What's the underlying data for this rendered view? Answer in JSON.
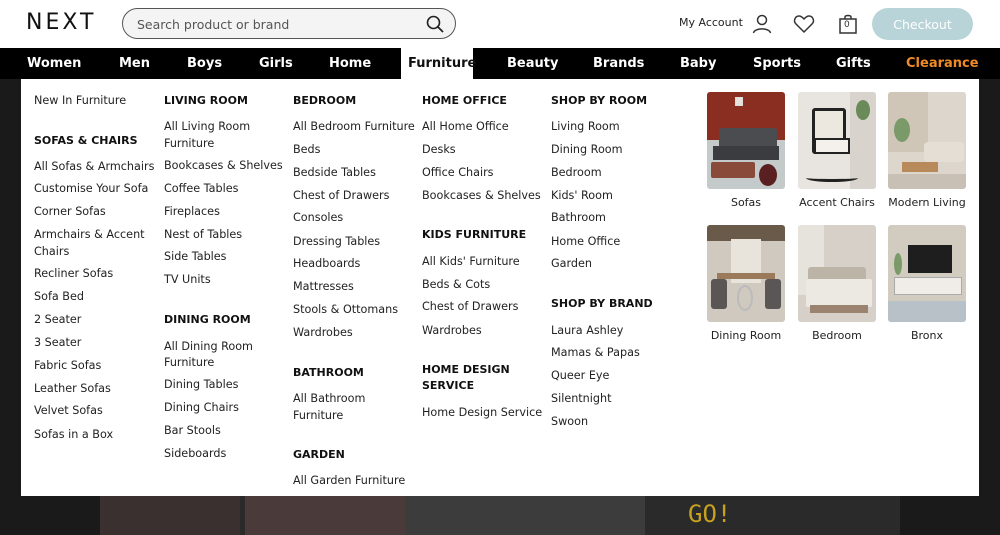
{
  "header": {
    "logo": "NEXT",
    "search_placeholder": "Search product or brand",
    "account_label": "My Account",
    "checkout_label": "Checkout",
    "bag_count": "0"
  },
  "nav": {
    "items": [
      "Women",
      "Men",
      "Boys",
      "Girls",
      "Home",
      "Furniture",
      "Beauty",
      "Brands",
      "Baby",
      "Sports",
      "Gifts",
      "Clearance"
    ],
    "active": "Furniture",
    "clearance_color": "#f08a24"
  },
  "menu": {
    "col1": {
      "new_in": "New In Furniture",
      "sofas_head": "SOFAS & CHAIRS",
      "sofas": [
        "All Sofas & Armchairs",
        "Customise Your Sofa",
        "Corner Sofas",
        "Armchairs & Accent",
        "Chairs",
        "Recliner Sofas",
        "Sofa Bed",
        "2 Seater",
        "3 Seater",
        "Fabric Sofas",
        "Leather Sofas",
        "Velvet Sofas",
        "Sofas in a Box"
      ]
    },
    "col2": {
      "living_head": "LIVING ROOM",
      "living": [
        "All Living Room",
        "Furniture",
        "Bookcases & Shelves",
        "Coffee Tables",
        "Fireplaces",
        "Nest of Tables",
        "Side Tables",
        "TV Units"
      ],
      "dining_head": "DINING ROOM",
      "dining": [
        "All Dining Room",
        "Furniture",
        "Dining Tables",
        "Dining Chairs",
        "Bar Stools",
        "Sideboards"
      ]
    },
    "col3": {
      "bedroom_head": "BEDROOM",
      "bedroom": [
        "All Bedroom Furniture",
        "Beds",
        "Bedside Tables",
        "Chest of Drawers",
        "Consoles",
        "Dressing Tables",
        "Headboards",
        "Mattresses",
        "Stools & Ottomans",
        "Wardrobes"
      ],
      "bathroom_head": "BATHROOM",
      "bathroom": [
        "All Bathroom",
        "Furniture"
      ],
      "garden_head": "GARDEN",
      "garden": [
        "All Garden Furniture"
      ]
    },
    "col4": {
      "office_head": "HOME OFFICE",
      "office": [
        "All Home Office",
        "Desks",
        "Office Chairs",
        "Bookcases & Shelves"
      ],
      "kids_head": "KIDS FURNITURE",
      "kids": [
        "All Kids' Furniture",
        "Beds & Cots",
        "Chest of Drawers",
        "Wardrobes"
      ],
      "design_head_1": "HOME DESIGN",
      "design_head_2": "SERVICE",
      "design": [
        "Home Design Service"
      ]
    },
    "col5": {
      "room_head": "SHOP BY ROOM",
      "rooms": [
        "Living Room",
        "Dining Room",
        "Bedroom",
        "Kids' Room",
        "Bathroom",
        "Home Office",
        "Garden"
      ],
      "brand_head": "SHOP BY BRAND",
      "brands": [
        "Laura Ashley",
        "Mamas & Papas",
        "Queer Eye",
        "Silentnight",
        "Swoon"
      ]
    },
    "tiles": [
      "Sofas",
      "Accent Chairs",
      "Modern Living",
      "Dining Room",
      "Bedroom",
      "Bronx"
    ]
  },
  "background": {
    "banner_text": "GO!"
  }
}
